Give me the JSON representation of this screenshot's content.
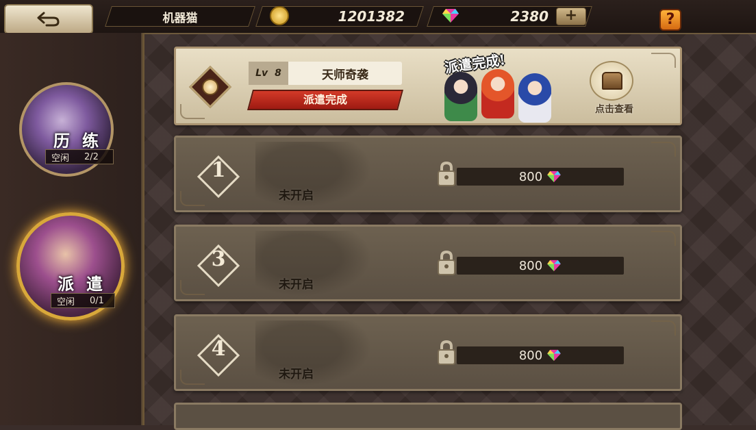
{
  "topbar": {
    "player_name": "机器猫",
    "gold": "1201382",
    "gems": "2380",
    "plus_label": "+",
    "help_label": "?"
  },
  "side_menu": [
    {
      "label": "历练",
      "status_label": "空闲",
      "status_value": "2/2",
      "selected": false
    },
    {
      "label": "派遣",
      "status_label": "空闲",
      "status_value": "0/1",
      "selected": true
    }
  ],
  "active_mission": {
    "level_tag": "Lv",
    "level": "8",
    "name": "天师奇袭",
    "status": "派遣完成",
    "banner": "派遣完成!",
    "chest_label": "点击查看"
  },
  "locked_slots": [
    {
      "number": "1",
      "label": "未开启",
      "cost": "800"
    },
    {
      "number": "3",
      "label": "未开启",
      "cost": "800"
    },
    {
      "number": "4",
      "label": "未开启",
      "cost": "800"
    }
  ],
  "colors": {
    "accent_gold": "#b39566",
    "status_red": "#c0281c",
    "card_light": "#e9dfc6",
    "card_locked": "#6d6150"
  }
}
